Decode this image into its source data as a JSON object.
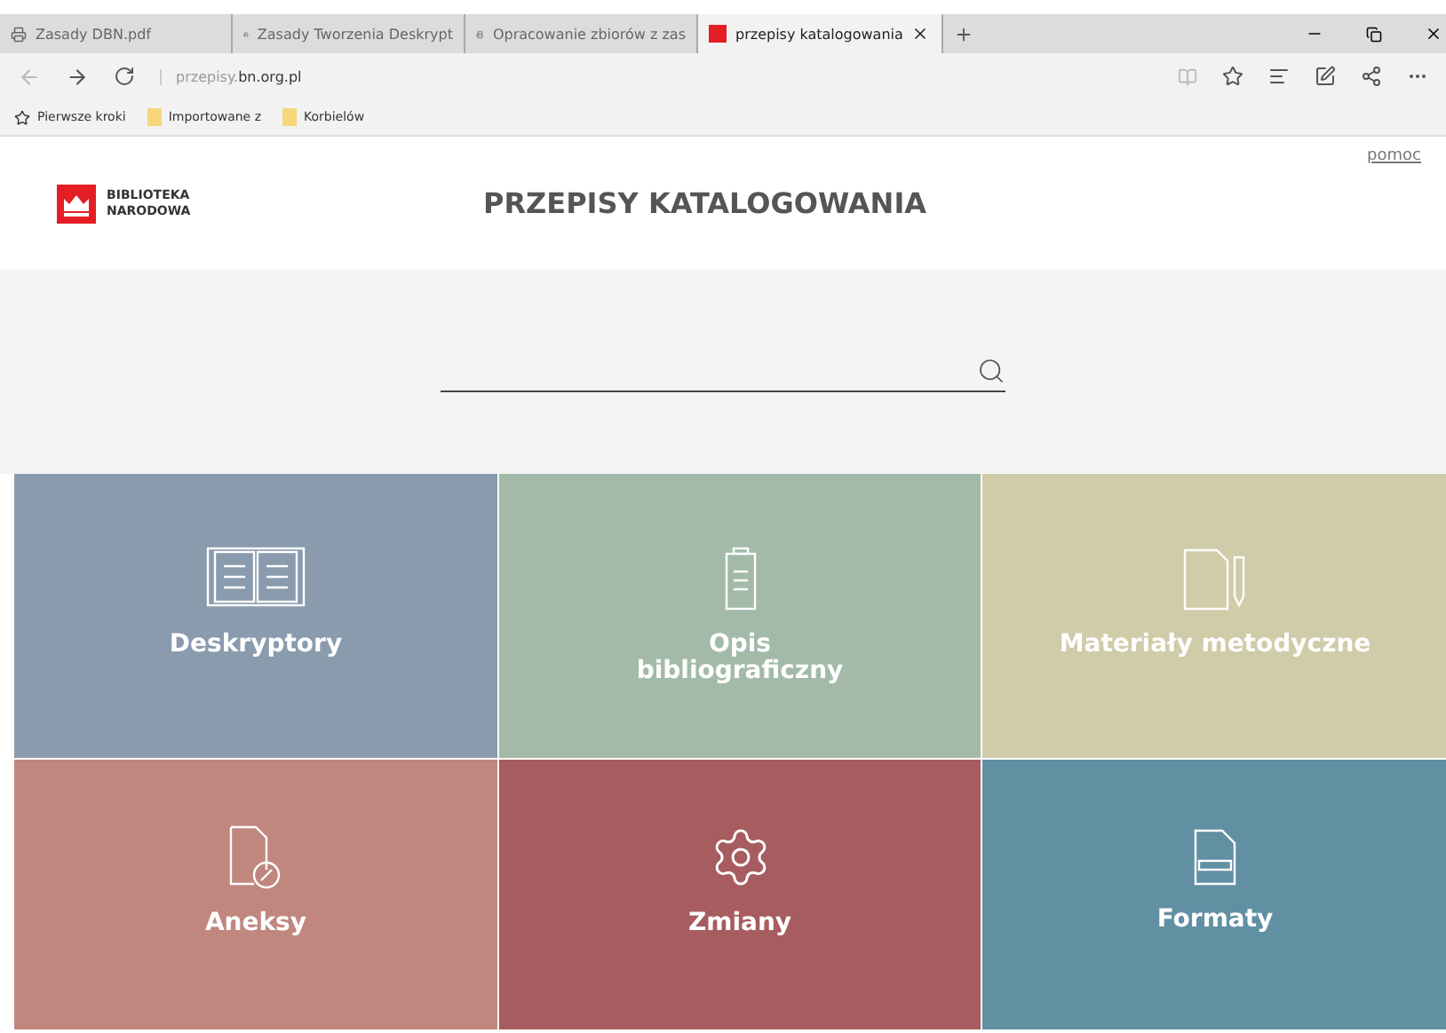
{
  "browser": {
    "tabs": [
      {
        "title": "Zasady DBN.pdf",
        "selected": false,
        "kind": "doc"
      },
      {
        "title": "Zasady Tworzenia Deskrypt",
        "selected": false,
        "kind": "doc"
      },
      {
        "title": "Opracowanie zbiorów z zas",
        "selected": false,
        "kind": "doc"
      },
      {
        "title": "przepisy katalogowania",
        "selected": true,
        "kind": "site"
      }
    ],
    "address": {
      "prefix": "przepisy.",
      "domain": "bn.org.pl"
    },
    "favorites": [
      {
        "label": "Pierwsze kroki",
        "kind": "star"
      },
      {
        "label": "Importowane z",
        "kind": "folder"
      },
      {
        "label": "Korbielów",
        "kind": "folder"
      }
    ]
  },
  "page": {
    "help_link": "pomoc",
    "logo": [
      "BIBLIOTEKA",
      "NARODOWA"
    ],
    "title": "PRZEPISY KATALOGOWANIA",
    "tiles": [
      {
        "label": "Deskryptory",
        "kind": "book",
        "color": "#8a9bae"
      },
      {
        "label": "Opis\nbibliograficzny",
        "kind": "clipboard",
        "color": "#a3baa9"
      },
      {
        "label": "Materiały metodyczne",
        "kind": "docpen",
        "color": "#d0cba8"
      },
      {
        "label": "Aneksy",
        "kind": "attach",
        "color": "#c0877f"
      },
      {
        "label": "Zmiany",
        "kind": "gear",
        "color": "#a75c60"
      },
      {
        "label": "Formaty",
        "kind": "format",
        "color": "#6190a3"
      }
    ]
  }
}
